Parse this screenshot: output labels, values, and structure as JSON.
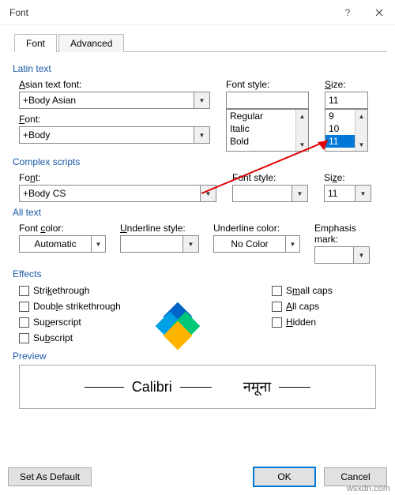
{
  "window": {
    "title": "Font"
  },
  "tabs": {
    "font": "Font",
    "advanced": "Advanced"
  },
  "latin": {
    "heading": "Latin text",
    "asian_label": "Asian text font:",
    "asian_value": "+Body Asian",
    "font_label": "Font:",
    "font_value": "+Body",
    "style_label": "Font style:",
    "style_items": {
      "a": "Regular",
      "b": "Italic",
      "c": "Bold"
    },
    "size_label": "Size:",
    "size_value": "11",
    "size_items": {
      "a": "9",
      "b": "10",
      "c": "11"
    }
  },
  "complex": {
    "heading": "Complex scripts",
    "font_label": "Font:",
    "font_value": "+Body CS",
    "style_label": "Font style:",
    "size_label": "Size:",
    "size_value": "11"
  },
  "alltext": {
    "heading": "All text",
    "color_label": "Font color:",
    "color_value": "Automatic",
    "ustyle_label": "Underline style:",
    "ucolor_label": "Underline color:",
    "ucolor_value": "No Color",
    "emph_label": "Emphasis mark:"
  },
  "effects": {
    "heading": "Effects",
    "strike": "Strikethrough",
    "dstrike": "Double strikethrough",
    "super": "Superscript",
    "sub": "Subscript",
    "smallcaps": "Small caps",
    "allcaps": "All caps",
    "hidden": "Hidden"
  },
  "preview": {
    "heading": "Preview",
    "a": "Calibri",
    "b": "नमूना"
  },
  "footer": {
    "default": "Set As Default",
    "ok": "OK",
    "cancel": "Cancel"
  },
  "watermark": "wsxdn.com"
}
